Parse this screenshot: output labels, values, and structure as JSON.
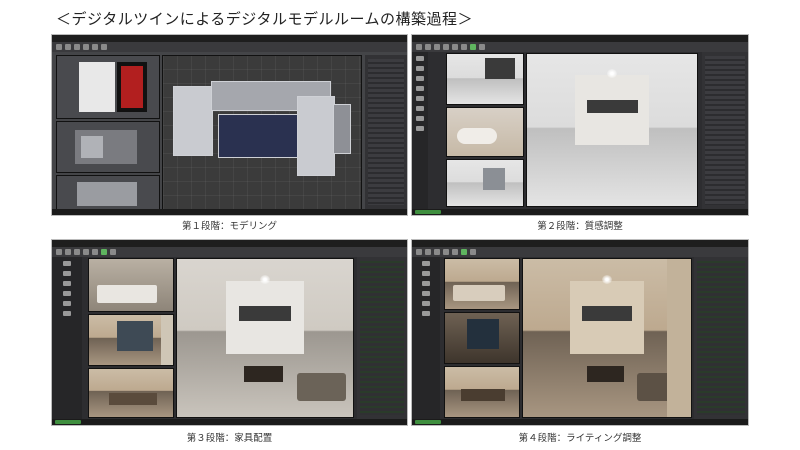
{
  "page_title": "＜デジタルツインによるデジタルモデルルームの構築過程＞",
  "stages": [
    {
      "caption": "第１段階：モデリング"
    },
    {
      "caption": "第２段階：質感調整"
    },
    {
      "caption": "第３段階：家具配置"
    },
    {
      "caption": "第４段階：ライティング調整"
    }
  ]
}
